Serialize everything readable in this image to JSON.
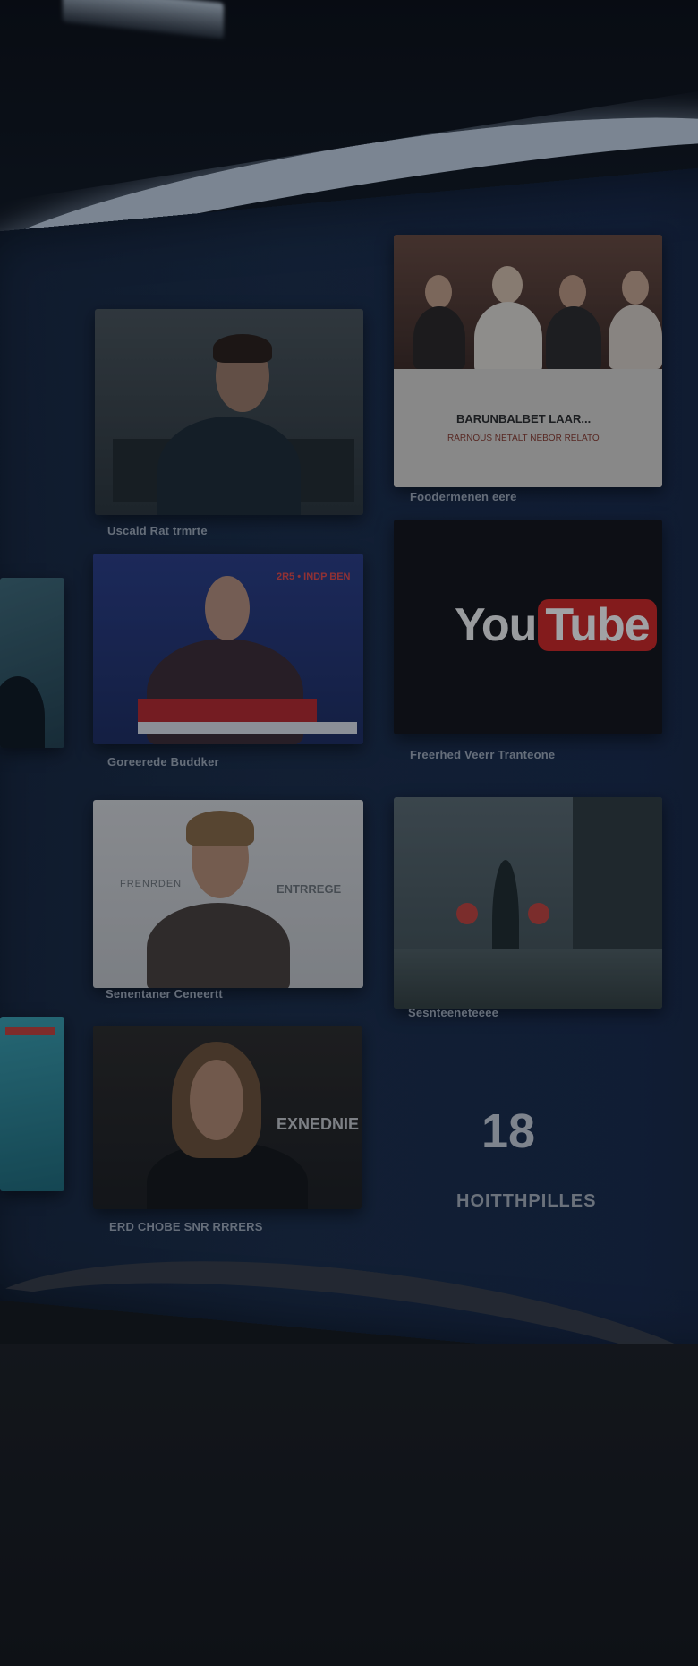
{
  "tiles": [
    {
      "id": "pedro-interview",
      "caption": "Uscald Rat trmrte"
    },
    {
      "id": "group-panel",
      "caption": "Foodermenen eere",
      "headline": "BARUNBALBET LAAR...",
      "subline": "RARNOUS NETALT NEBOR RELATO"
    },
    {
      "id": "news-broadcast",
      "caption": "Goreerede Buddker",
      "banner": "2R5 • INDP BEN"
    },
    {
      "id": "youtube",
      "caption": "Freerhed Veerr Tranteone",
      "logo_you": "You",
      "logo_tube": "Tube"
    },
    {
      "id": "thinking-man",
      "caption": "Senentaner Ceneertt",
      "side_left": "FRENRDEN",
      "side_right": "ENTRREGE"
    },
    {
      "id": "rainy-street",
      "caption": "Sesnteeneteeee"
    },
    {
      "id": "long-hair-man",
      "caption": "ERD CHOBE SNR RRRERS",
      "overlay": "EXNEDNIE"
    },
    {
      "id": "counter",
      "big_number": "18",
      "label": "HOITTHPILLES"
    }
  ],
  "colors": {
    "wall": "#1a2c48",
    "light": "#c3d1e0",
    "youtube_red": "#d12622"
  }
}
